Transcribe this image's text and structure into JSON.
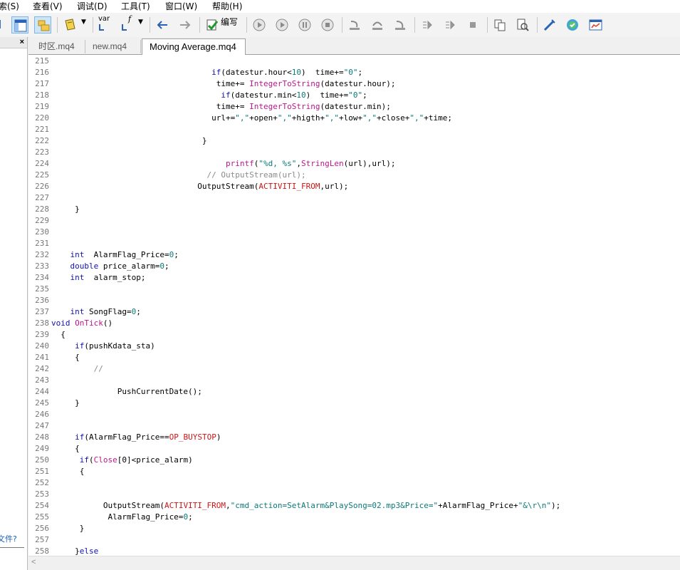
{
  "menu": [
    "索(S)",
    "查看(V)",
    "调试(D)",
    "工具(T)",
    "窗口(W)",
    "帮助(H)"
  ],
  "toolbar": {
    "compile_label": "编写",
    "var_label": "var",
    "func_label": "f"
  },
  "left_panel": {
    "close_glyph": "×",
    "bottom_link": "文件?"
  },
  "tabs": [
    "时区.mq4",
    "new.mq4",
    "Moving Average.mq4"
  ],
  "active_tab": 2,
  "colors": {
    "keyword": "#1010b8",
    "function": "#c0148c",
    "string": "#0a7a7a",
    "comment": "#8a8a8a",
    "macro": "#d01414"
  },
  "scroll_left_glyph": "<",
  "code_lines": [
    {
      "n": "215",
      "parts": []
    },
    {
      "n": "216",
      "parts": [
        [
          "",
          "                                  "
        ],
        [
          "kw",
          "if"
        ],
        [
          "",
          "(datestur.hour<"
        ],
        [
          "num",
          "10"
        ],
        [
          "",
          ")  time+="
        ],
        [
          "str",
          "\"0\""
        ],
        [
          "",
          ";"
        ]
      ]
    },
    {
      "n": "217",
      "parts": [
        [
          "",
          "                                   time+= "
        ],
        [
          "fn",
          "IntegerToString"
        ],
        [
          "",
          "(datestur.hour);"
        ]
      ]
    },
    {
      "n": "218",
      "parts": [
        [
          "",
          "                                    "
        ],
        [
          "kw",
          "if"
        ],
        [
          "",
          "(datestur.min<"
        ],
        [
          "num",
          "10"
        ],
        [
          "",
          ")  time+="
        ],
        [
          "str",
          "\"0\""
        ],
        [
          "",
          ";"
        ]
      ]
    },
    {
      "n": "219",
      "parts": [
        [
          "",
          "                                   time+= "
        ],
        [
          "fn",
          "IntegerToString"
        ],
        [
          "",
          "(datestur.min);"
        ]
      ]
    },
    {
      "n": "220",
      "parts": [
        [
          "",
          "                                  url+="
        ],
        [
          "str",
          "\",\""
        ],
        [
          "",
          "+open+"
        ],
        [
          "str",
          "\",\""
        ],
        [
          "",
          "+higth+"
        ],
        [
          "str",
          "\",\""
        ],
        [
          "",
          "+low+"
        ],
        [
          "str",
          "\",\""
        ],
        [
          "",
          "+close+"
        ],
        [
          "str",
          "\",\""
        ],
        [
          "",
          "+time;"
        ]
      ]
    },
    {
      "n": "221",
      "parts": []
    },
    {
      "n": "222",
      "parts": [
        [
          "",
          "                                }"
        ]
      ]
    },
    {
      "n": "223",
      "parts": []
    },
    {
      "n": "224",
      "parts": [
        [
          "",
          "                                     "
        ],
        [
          "fn",
          "printf"
        ],
        [
          "",
          "("
        ],
        [
          "str",
          "\"%d, %s\""
        ],
        [
          "",
          ","
        ],
        [
          "fn",
          "StringLen"
        ],
        [
          "",
          "(url),url);"
        ]
      ]
    },
    {
      "n": "225",
      "parts": [
        [
          "",
          "                                 "
        ],
        [
          "cmt",
          "// OutputStream(url);"
        ]
      ]
    },
    {
      "n": "226",
      "parts": [
        [
          "",
          "                               OutputStream("
        ],
        [
          "mac",
          "ACTIVITI_FROM"
        ],
        [
          "",
          ",url);"
        ]
      ]
    },
    {
      "n": "227",
      "parts": []
    },
    {
      "n": "228",
      "parts": [
        [
          "",
          "     }"
        ]
      ]
    },
    {
      "n": "229",
      "parts": []
    },
    {
      "n": "230",
      "parts": []
    },
    {
      "n": "231",
      "parts": []
    },
    {
      "n": "232",
      "parts": [
        [
          "",
          "    "
        ],
        [
          "kw",
          "int"
        ],
        [
          "",
          "  AlarmFlag_Price="
        ],
        [
          "num",
          "0"
        ],
        [
          "",
          ";"
        ]
      ]
    },
    {
      "n": "233",
      "parts": [
        [
          "",
          "    "
        ],
        [
          "kw",
          "double"
        ],
        [
          "",
          " price_alarm="
        ],
        [
          "num",
          "0"
        ],
        [
          "",
          ";"
        ]
      ]
    },
    {
      "n": "234",
      "parts": [
        [
          "",
          "    "
        ],
        [
          "kw",
          "int"
        ],
        [
          "",
          "  alarm_stop;"
        ]
      ]
    },
    {
      "n": "235",
      "parts": []
    },
    {
      "n": "236",
      "parts": []
    },
    {
      "n": "237",
      "parts": [
        [
          "",
          "    "
        ],
        [
          "kw",
          "int"
        ],
        [
          "",
          " SongFlag="
        ],
        [
          "num",
          "0"
        ],
        [
          "",
          ";"
        ]
      ]
    },
    {
      "n": "238",
      "parts": [
        [
          "kw",
          "void"
        ],
        [
          "",
          " "
        ],
        [
          "fn",
          "OnTick"
        ],
        [
          "",
          "()"
        ]
      ]
    },
    {
      "n": "239",
      "parts": [
        [
          "",
          "  {"
        ]
      ]
    },
    {
      "n": "240",
      "parts": [
        [
          "",
          "     "
        ],
        [
          "kw",
          "if"
        ],
        [
          "",
          "(pushKdata_sta)"
        ]
      ]
    },
    {
      "n": "241",
      "parts": [
        [
          "",
          "     {"
        ]
      ]
    },
    {
      "n": "242",
      "parts": [
        [
          "",
          "         "
        ],
        [
          "cmt",
          "//"
        ]
      ]
    },
    {
      "n": "243",
      "parts": []
    },
    {
      "n": "244",
      "parts": [
        [
          "",
          "              PushCurrentDate();"
        ]
      ]
    },
    {
      "n": "245",
      "parts": [
        [
          "",
          "     }"
        ]
      ]
    },
    {
      "n": "246",
      "parts": []
    },
    {
      "n": "247",
      "parts": []
    },
    {
      "n": "248",
      "parts": [
        [
          "",
          "     "
        ],
        [
          "kw",
          "if"
        ],
        [
          "",
          "(AlarmFlag_Price=="
        ],
        [
          "mac",
          "OP_BUYSTOP"
        ],
        [
          "",
          ")"
        ]
      ]
    },
    {
      "n": "249",
      "parts": [
        [
          "",
          "     {"
        ]
      ]
    },
    {
      "n": "250",
      "parts": [
        [
          "",
          "      "
        ],
        [
          "kw",
          "if"
        ],
        [
          "",
          "("
        ],
        [
          "fn",
          "Close"
        ],
        [
          "",
          "[0]<price_alarm)"
        ]
      ]
    },
    {
      "n": "251",
      "parts": [
        [
          "",
          "      {"
        ]
      ]
    },
    {
      "n": "252",
      "parts": []
    },
    {
      "n": "253",
      "parts": []
    },
    {
      "n": "254",
      "parts": [
        [
          "",
          "           OutputStream("
        ],
        [
          "mac",
          "ACTIVITI_FROM"
        ],
        [
          "",
          ","
        ],
        [
          "str",
          "\"cmd_action=SetAlarm&PlaySong=02.mp3&Price=\""
        ],
        [
          "",
          "+AlarmFlag_Price+"
        ],
        [
          "str",
          "\"&\\r\\n\""
        ],
        [
          "",
          ");"
        ]
      ]
    },
    {
      "n": "255",
      "parts": [
        [
          "",
          "            AlarmFlag_Price="
        ],
        [
          "num",
          "0"
        ],
        [
          "",
          ";"
        ]
      ]
    },
    {
      "n": "256",
      "parts": [
        [
          "",
          "      }"
        ]
      ]
    },
    {
      "n": "257",
      "parts": []
    },
    {
      "n": "258",
      "parts": [
        [
          "",
          "     }"
        ],
        [
          "kw",
          "else"
        ]
      ]
    }
  ]
}
